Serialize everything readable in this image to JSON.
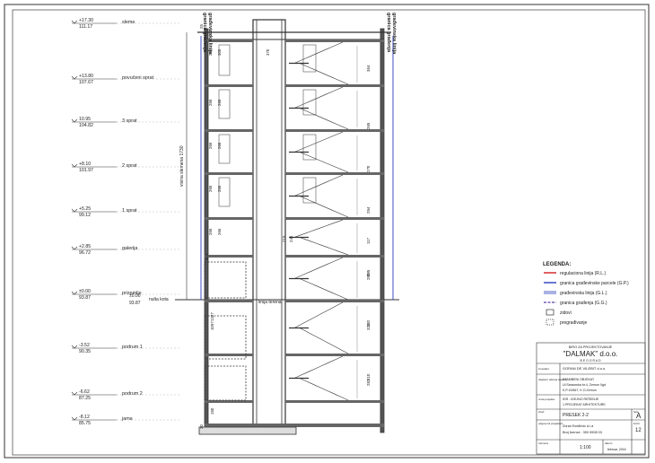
{
  "levels": [
    {
      "elev": "+17.30",
      "abs": "111.17",
      "name": "sleme"
    },
    {
      "elev": "+13.80",
      "abs": "107.67",
      "name": "povučeni sprat"
    },
    {
      "elev": "10.95",
      "abs": "104.82",
      "name": "3 sprat"
    },
    {
      "elev": "+8.10",
      "abs": "101.97",
      "name": "2 sprat"
    },
    {
      "elev": "+5.25",
      "abs": "99.12",
      "name": "1 sprat"
    },
    {
      "elev": "+2.85",
      "abs": "96.72",
      "name": "galerija"
    },
    {
      "elev": "±0.00",
      "abs": "93.87",
      "name": "prizemlje"
    },
    {
      "elev": "-3.52",
      "abs": "90.35",
      "name": "podrum 1"
    },
    {
      "elev": "-6.62",
      "abs": "87.25",
      "name": "podrum 2"
    },
    {
      "elev": "-8.12",
      "abs": "85.75",
      "name": "jama"
    }
  ],
  "section": {
    "ground_elev": "±0.00",
    "ground_abs": "93.87",
    "ground_label": "nulta kota",
    "terrain_label": "linija terena",
    "height_label": "visina slemena 1730",
    "vertical_labels": [
      "granica građenja",
      "građevinska linija"
    ]
  },
  "dimensions": {
    "wall": [
      "227",
      "280",
      "300",
      "266",
      "266",
      "266",
      "266",
      "266",
      "266",
      "266",
      "266",
      "465",
      "1327",
      "1097"
    ],
    "stair": [
      "370",
      "364",
      "265",
      "270",
      "254",
      "117",
      "215",
      "240",
      "285",
      "280",
      "282",
      "324",
      "310",
      "282",
      "150",
      "30",
      "25"
    ]
  },
  "legend": {
    "title": "LEGENDA:",
    "items": [
      {
        "label": "regulaciona linija (R.L.)",
        "color": "#d21d1d",
        "style": "solid"
      },
      {
        "label": "granica građevinske parcele (G.P.)",
        "color": "#2b3bbd",
        "style": "solid"
      },
      {
        "label": "građevinska linija (G.L.)",
        "color": "#2b3bbd",
        "style": "double"
      },
      {
        "label": "granica građenja (G.G.)",
        "color": "#5a3fa8",
        "style": "dash"
      },
      {
        "label": "zidovi",
        "color": "#333333",
        "style": "box"
      },
      {
        "label": "pregrađivanje",
        "color": "#333333",
        "style": "dotbox"
      }
    ]
  },
  "title_block": {
    "company_small": "BIRO ZA PROJEKTOVANJE",
    "company_name": "\"DALMAK\" d.o.o.",
    "city": "B E O G R A D",
    "investor_label": "investitor",
    "investor": "GORAN DE VILEBIT d.o.o.",
    "object_label": "objekat i adresa objekta",
    "object_lines": [
      "STAMBENI OBJEKAT",
      "Ul.Saraorska br.4, Zemun 0gd",
      "K.P.10/667, K.O.Zemun"
    ],
    "project_label": "vrsta projekta",
    "project_lines": [
      "IDR - IDEJNO REŠENJE",
      "1.PROJEKAT ARHITEKTURE"
    ],
    "drawing_label": "crtež",
    "drawing": "PRESEK 2-2",
    "sheet_label": "faza",
    "sheet": "A",
    "author_label": "odgovorni projektant",
    "author_lines": [
      "Zoran Đorđević d.i.a",
      "Broj licence : 300 5908 03"
    ],
    "number_label": "list br.",
    "number": "12",
    "scale_label": "razmera",
    "scale": "1:100",
    "date_label": "datum",
    "date": "februar, 2016"
  }
}
